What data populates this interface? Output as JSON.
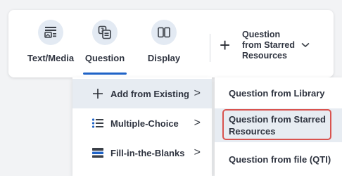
{
  "toolbar": {
    "tools": [
      {
        "label": "Text/Media",
        "icon": "text-media-icon",
        "active": false
      },
      {
        "label": "Question",
        "icon": "question-icon",
        "active": true
      },
      {
        "label": "Display",
        "icon": "display-icon",
        "active": false
      }
    ],
    "starred": {
      "label": "Question from Starred Resources",
      "icon": "plus-icon",
      "chevron": "chevron-down-icon"
    }
  },
  "menu": {
    "items": [
      {
        "label": "Add from Existing",
        "icon": "plus-icon",
        "chevron": ">"
      },
      {
        "label": "Multiple-Choice",
        "icon": "list-icon",
        "chevron": ">"
      },
      {
        "label": "Fill-in-the-Blanks",
        "icon": "blanks-icon",
        "chevron": ">"
      }
    ]
  },
  "submenu": {
    "items": [
      {
        "label": "Question from Library"
      },
      {
        "label": "Question from Starred Resources"
      },
      {
        "label": "Question from file (QTI)"
      }
    ]
  },
  "colors": {
    "accent": "#1f63c7",
    "icon_bg": "#e3eaf3",
    "hover_bg": "#e7ecf2",
    "highlight": "#d9534f"
  }
}
